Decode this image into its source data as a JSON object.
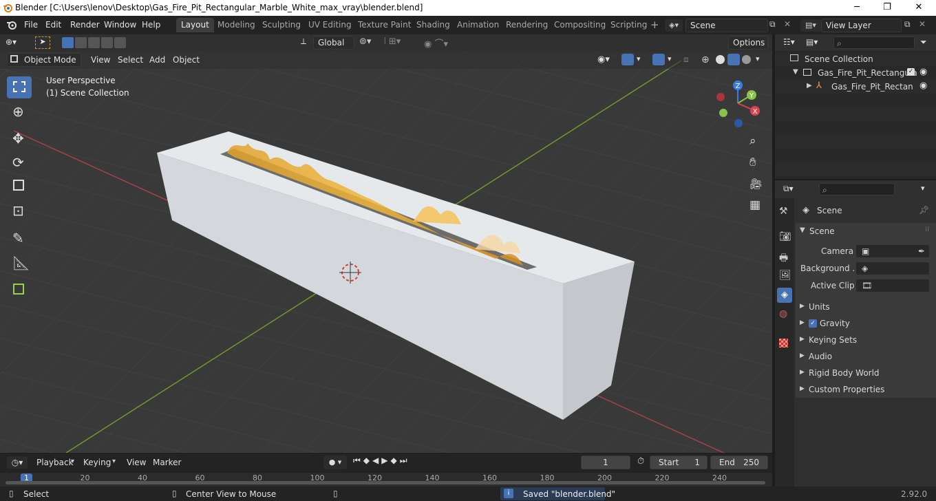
{
  "window": {
    "title": "Blender [C:\\Users\\lenov\\Desktop\\Gas_Fire_Pit_Rectangular_Marble_White_max_vray\\blender.blend]",
    "controls": [
      "─",
      "❐",
      "✕"
    ]
  },
  "menu": [
    "File",
    "Edit",
    "Render",
    "Window",
    "Help"
  ],
  "workspaces": [
    "Layout",
    "Modeling",
    "Sculpting",
    "UV Editing",
    "Texture Paint",
    "Shading",
    "Animation",
    "Rendering",
    "Compositing",
    "Scripting"
  ],
  "active_workspace": "Layout",
  "scene_field": "Scene",
  "view_layer_field": "View Layer",
  "tool_header": {
    "orientation": "Global",
    "options": "Options"
  },
  "viewport_header": {
    "mode": "Object Mode",
    "menus": [
      "View",
      "Select",
      "Add",
      "Object"
    ]
  },
  "viewport": {
    "perspective": "User Perspective",
    "collection": "(1) Scene Collection",
    "gizmo": {
      "z": "Z",
      "y": "Y",
      "x": "X"
    }
  },
  "outliner": {
    "root": "Scene Collection",
    "items": [
      {
        "label": "Gas_Fire_Pit_Rectangula"
      },
      {
        "label": "Gas_Fire_Pit_Rectan"
      }
    ]
  },
  "properties": {
    "context": "Scene",
    "panel": "Scene",
    "camera_label": "Camera",
    "background_label": "Background ...",
    "active_clip_label": "Active Clip",
    "sections": [
      "Units",
      "Gravity",
      "Keying Sets",
      "Audio",
      "Rigid Body World",
      "Custom Properties"
    ],
    "gravity_checked": true
  },
  "timeline": {
    "menus": [
      "Playback",
      "Keying",
      "View",
      "Marker"
    ],
    "current_frame": "1",
    "start_label": "Start",
    "start": "1",
    "end_label": "End",
    "end": "250",
    "ruler": [
      "1",
      "20",
      "40",
      "60",
      "80",
      "100",
      "120",
      "140",
      "160",
      "180",
      "200",
      "220",
      "240"
    ]
  },
  "status": {
    "select": "Select",
    "center": "Center View to Mouse",
    "message": "Saved \"blender.blend\"",
    "version": "2.92.0"
  },
  "colors": {
    "accent": "#4772b3",
    "header": "#232323",
    "viewport": "#393939",
    "x_axis": "#d8454f",
    "y_axis": "#8bc34a",
    "z_axis": "#3b7de0"
  }
}
